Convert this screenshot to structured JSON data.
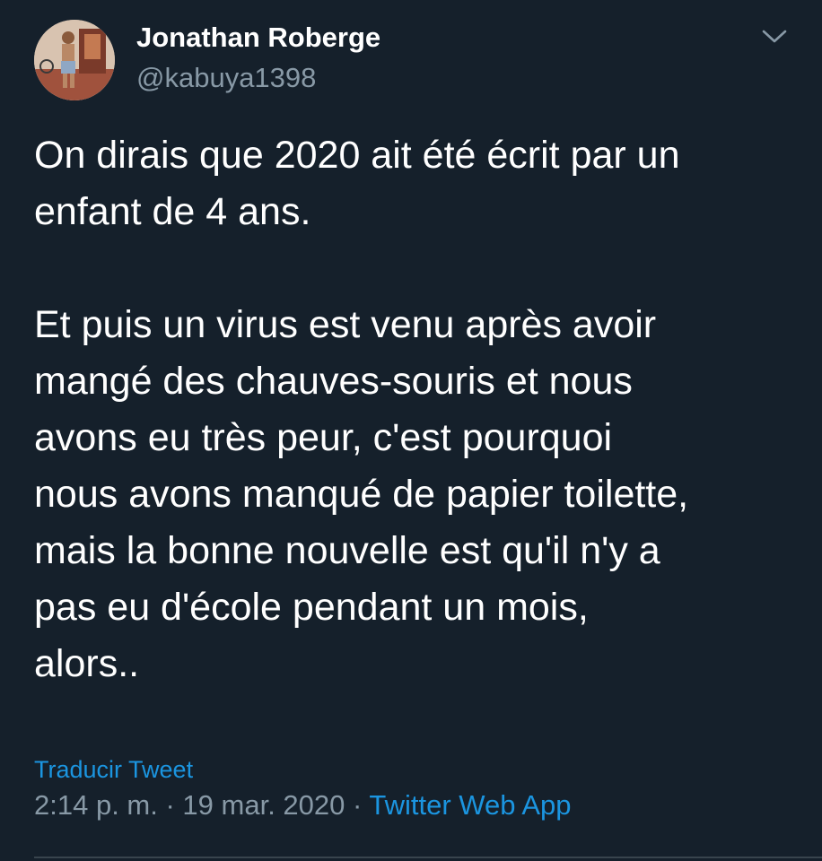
{
  "user": {
    "display_name": "Jonathan Roberge",
    "handle": "@kabuya1398"
  },
  "tweet": {
    "paragraphs": [
      "On dirais que 2020 ait été écrit par un\nenfant de 4 ans.",
      "Et puis un virus est venu après avoir\nmangé des chauves-souris et nous\navons eu très peur, c'est pourquoi\nnous avons manqué de papier toilette,\nmais la bonne nouvelle est qu'il n'y a\npas eu d'école pendant un mois,\nalors.."
    ],
    "translate_label": "Traducir Tweet",
    "time": "2:14 p. m.",
    "separator": " · ",
    "date": "19 mar. 2020",
    "source": "Twitter Web App"
  },
  "icons": {
    "menu": "chevron-down-icon",
    "avatar": "avatar"
  },
  "colors": {
    "background": "#15202b",
    "text_primary": "#ffffff",
    "text_secondary": "#8899a6",
    "accent": "#1b95e0",
    "divider": "#38444d"
  }
}
